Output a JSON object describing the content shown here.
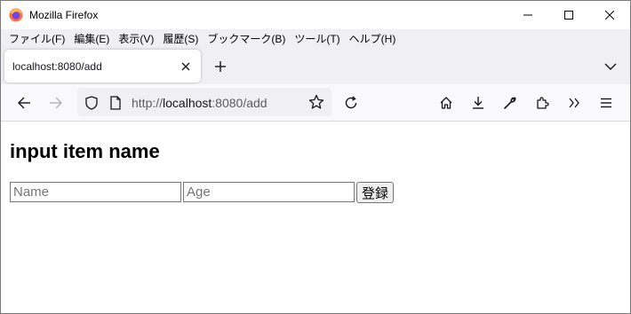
{
  "window": {
    "title": "Mozilla Firefox",
    "icons": {
      "app": "firefox-icon",
      "minimize": "minimize-icon",
      "maximize": "maximize-icon",
      "close": "close-icon"
    }
  },
  "menubar": {
    "items": [
      "ファイル(F)",
      "編集(E)",
      "表示(V)",
      "履歴(S)",
      "ブックマーク(B)",
      "ツール(T)",
      "ヘルプ(H)"
    ]
  },
  "tabs": [
    {
      "label": "localhost:8080/add",
      "active": true
    }
  ],
  "navbar": {
    "url_scheme": "http://",
    "url_host": "localhost",
    "url_rest": ":8080/add",
    "icons": [
      "back-arrow-icon",
      "forward-arrow-icon",
      "shield-icon",
      "page-icon",
      "star-icon",
      "reload-icon",
      "home-icon",
      "download-icon",
      "wrench-icon",
      "extensions-icon",
      "overflow-chevrons-icon",
      "hamburger-menu-icon"
    ]
  },
  "page": {
    "heading": "input item name",
    "name_placeholder": "Name",
    "age_placeholder": "Age",
    "submit_label": "登録"
  },
  "colors": {
    "chrome_bg": "#f0f0f4",
    "navbar_bg": "#f9f9fb",
    "urlbar_bg": "#f0f0f4",
    "text": "#15141a"
  }
}
